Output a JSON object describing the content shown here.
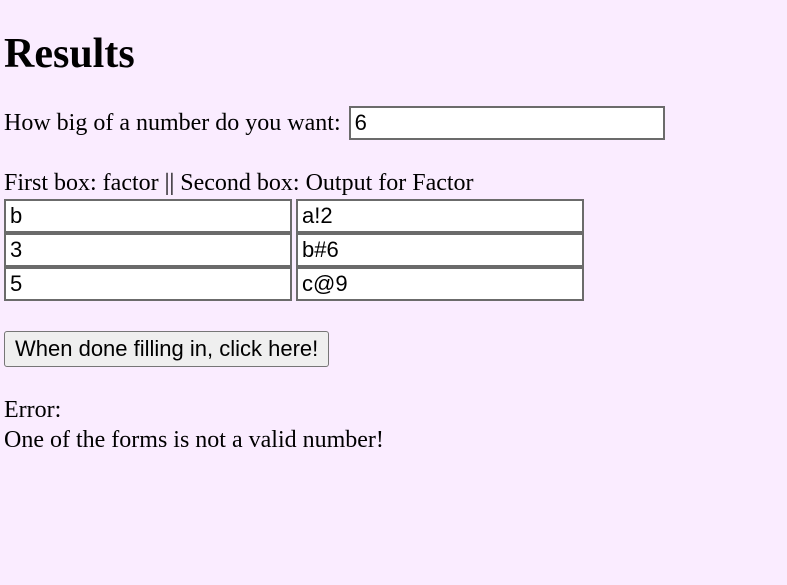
{
  "heading": "Results",
  "prompt_label": "How big of a number do you want: ",
  "size_value": "6",
  "rows_label": "First box: factor || Second box: Output for Factor",
  "rows": [
    {
      "factor": "b",
      "output": "a!2"
    },
    {
      "factor": "3",
      "output": "b#6"
    },
    {
      "factor": "5",
      "output": "c@9"
    }
  ],
  "submit_label": "When done filling in, click here!",
  "error_label": "Error:",
  "error_message": "One of the forms is not a valid number!"
}
